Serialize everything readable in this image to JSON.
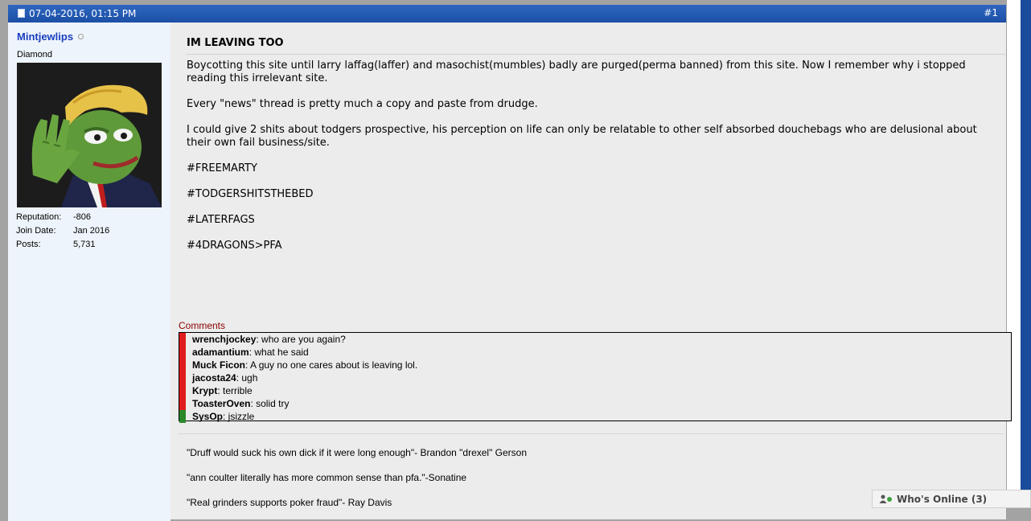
{
  "post": {
    "date": "07-04-2016, 01:15 PM",
    "number": "#1",
    "title": "IM LEAVING TOO",
    "message": [
      "Boycotting this site until larry laffag(laffer) and masochist(mumbles) badly are purged(perma banned) from this site. Now I remember why i stopped reading this irrelevant site.",
      "Every \"news\" thread is pretty much a copy and paste from drudge.",
      "I could give 2 shits about todgers prospective, his perception on life can only be relatable to other self absorbed douchebags who are delusional about their own fail business/site.",
      "#FREEMARTY",
      "#TODGERSHITSTHEBED",
      "#LATERFAGS",
      "#4DRAGONS>PFA"
    ]
  },
  "user": {
    "name": "Mintjewlips",
    "title": "Diamond",
    "stats": [
      {
        "label": "Reputation:",
        "value": "-806"
      },
      {
        "label": "Join Date:",
        "value": "Jan 2016"
      },
      {
        "label": "Posts:",
        "value": "5,731"
      }
    ]
  },
  "comments": {
    "label": "Comments",
    "items": [
      {
        "author": "wrenchjockey",
        "text": ": who are you again?",
        "color": "#e01b1b"
      },
      {
        "author": "adamantium",
        "text": ": what he said",
        "color": "#e01b1b"
      },
      {
        "author": "Muck Ficon",
        "text": ": A guy no one cares about is leaving lol.",
        "color": "#e01b1b"
      },
      {
        "author": "jacosta24",
        "text": ": ugh",
        "color": "#e01b1b"
      },
      {
        "author": "Krypt",
        "text": ": terrible",
        "color": "#e01b1b"
      },
      {
        "author": "ToasterOven",
        "text": ": solid try",
        "color": "#e01b1b"
      },
      {
        "author": "SysOp",
        "text": ": jsizzle",
        "color": "#2a8a2a"
      }
    ]
  },
  "signature": [
    "\"Druff would suck his own dick if it were long enough\"- Brandon \"drexel\" Gerson",
    "\"ann coulter literally has more common sense than pfa.\"-Sonatine",
    "\"Real grinders supports poker fraud\"- Ray Davis"
  ],
  "whos_online": {
    "label": "Who's Online (3)",
    "icon": "users-online-icon"
  },
  "colors": {
    "header_blue": "#1c4fa6",
    "username_blue": "#1a3fbf",
    "comments_label": "#8b0000",
    "comment_bar_red": "#e01b1b",
    "comment_bar_green": "#2a8a2a"
  }
}
